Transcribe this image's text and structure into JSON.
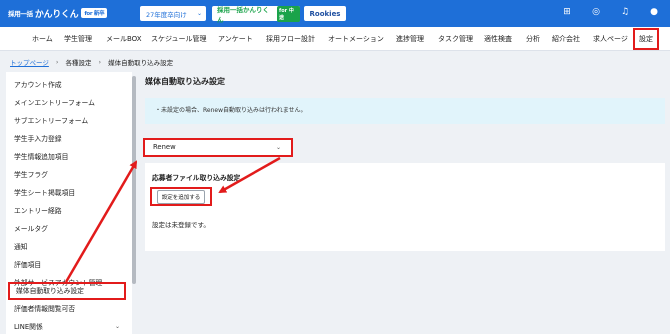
{
  "header": {
    "logo_prefix": "採用一括",
    "logo_text": "かんりくん",
    "logo_badge": "for 新卒",
    "year_select": "27年度卒向け",
    "brand2": "採用一括かんりくん",
    "brand2_badge": "for 中途",
    "brand3": "Rookies",
    "icons": [
      "grid-icon",
      "support-icon",
      "bell-icon",
      "user-icon"
    ]
  },
  "nav": {
    "items": [
      "ホーム",
      "学生管理",
      "メールBOX",
      "スケジュール管理",
      "アンケート",
      "採用フロー設計",
      "オートメーション",
      "進捗管理",
      "タスク管理",
      "適性検査",
      "分析",
      "紹介会社",
      "求人ページ",
      "設定"
    ],
    "active": "設定"
  },
  "breadcrumb": [
    "トップページ",
    "各種設定",
    "媒体自動取り込み設定"
  ],
  "sidebar": {
    "items": [
      {
        "label": "アカウント作成"
      },
      {
        "label": "メインエントリーフォーム"
      },
      {
        "label": "サブエントリーフォーム"
      },
      {
        "label": "学生手入力登録"
      },
      {
        "label": "学生情報追加項目"
      },
      {
        "label": "学生フラグ"
      },
      {
        "label": "学生シート掲載項目"
      },
      {
        "label": "エントリー経路"
      },
      {
        "label": "メールタグ"
      },
      {
        "label": "通知"
      },
      {
        "label": "評価項目"
      },
      {
        "label": "外部サービスアカウント管理"
      },
      {
        "label": "媒体自動取り込み設定"
      },
      {
        "label": "評価者情報閲覧可否"
      },
      {
        "label": "LINE関係"
      }
    ],
    "active_index": 12
  },
  "main": {
    "title": "媒体自動取り込み設定",
    "notice": "・未設定の場合、Renew自動取り込みは行われません。",
    "select_value": "Renew",
    "panel_title": "応募者ファイル取り込み設定",
    "add_button": "設定を追加する",
    "empty_text": "設定は未登録です。"
  },
  "colors": {
    "header_blue": "#1e6fd8",
    "highlight_red": "#e21b1b",
    "notice_bg": "#e1f4fb"
  }
}
